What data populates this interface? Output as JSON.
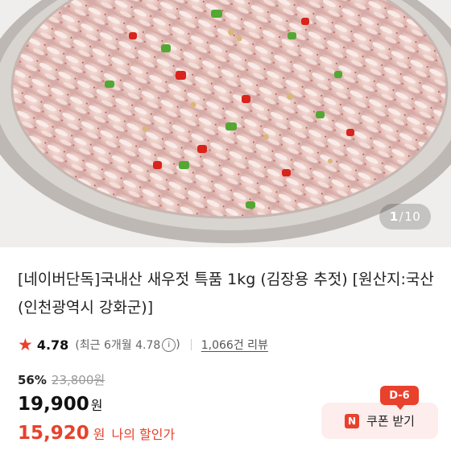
{
  "gallery": {
    "image_alt": "salted shrimp in a bowl",
    "counter_current": "1",
    "counter_sep": "/",
    "counter_total": "10"
  },
  "product": {
    "title": "[네이버단독]국내산 새우젓 특품 1kg (김장용 추젓) [원산지:국산(인천광역시 강화군)]"
  },
  "rating": {
    "star_icon": "star-icon",
    "score": "4.78",
    "recent": "(최근 6개월 4.78",
    "recent_close": ")",
    "info_icon": "i",
    "reviews": "1,066건 리뷰"
  },
  "pricing": {
    "discount_rate": "56%",
    "original_price": "23,800원",
    "price": "19,900",
    "price_unit": "원",
    "my_price": "15,920",
    "my_price_unit": "원",
    "my_price_label": "나의 할인가"
  },
  "coupon": {
    "dday_badge": "D-6",
    "icon_letter": "N",
    "label": "쿠폰 받기"
  },
  "colors": {
    "accent": "#e8412c",
    "coupon_bg": "#fdeded"
  }
}
